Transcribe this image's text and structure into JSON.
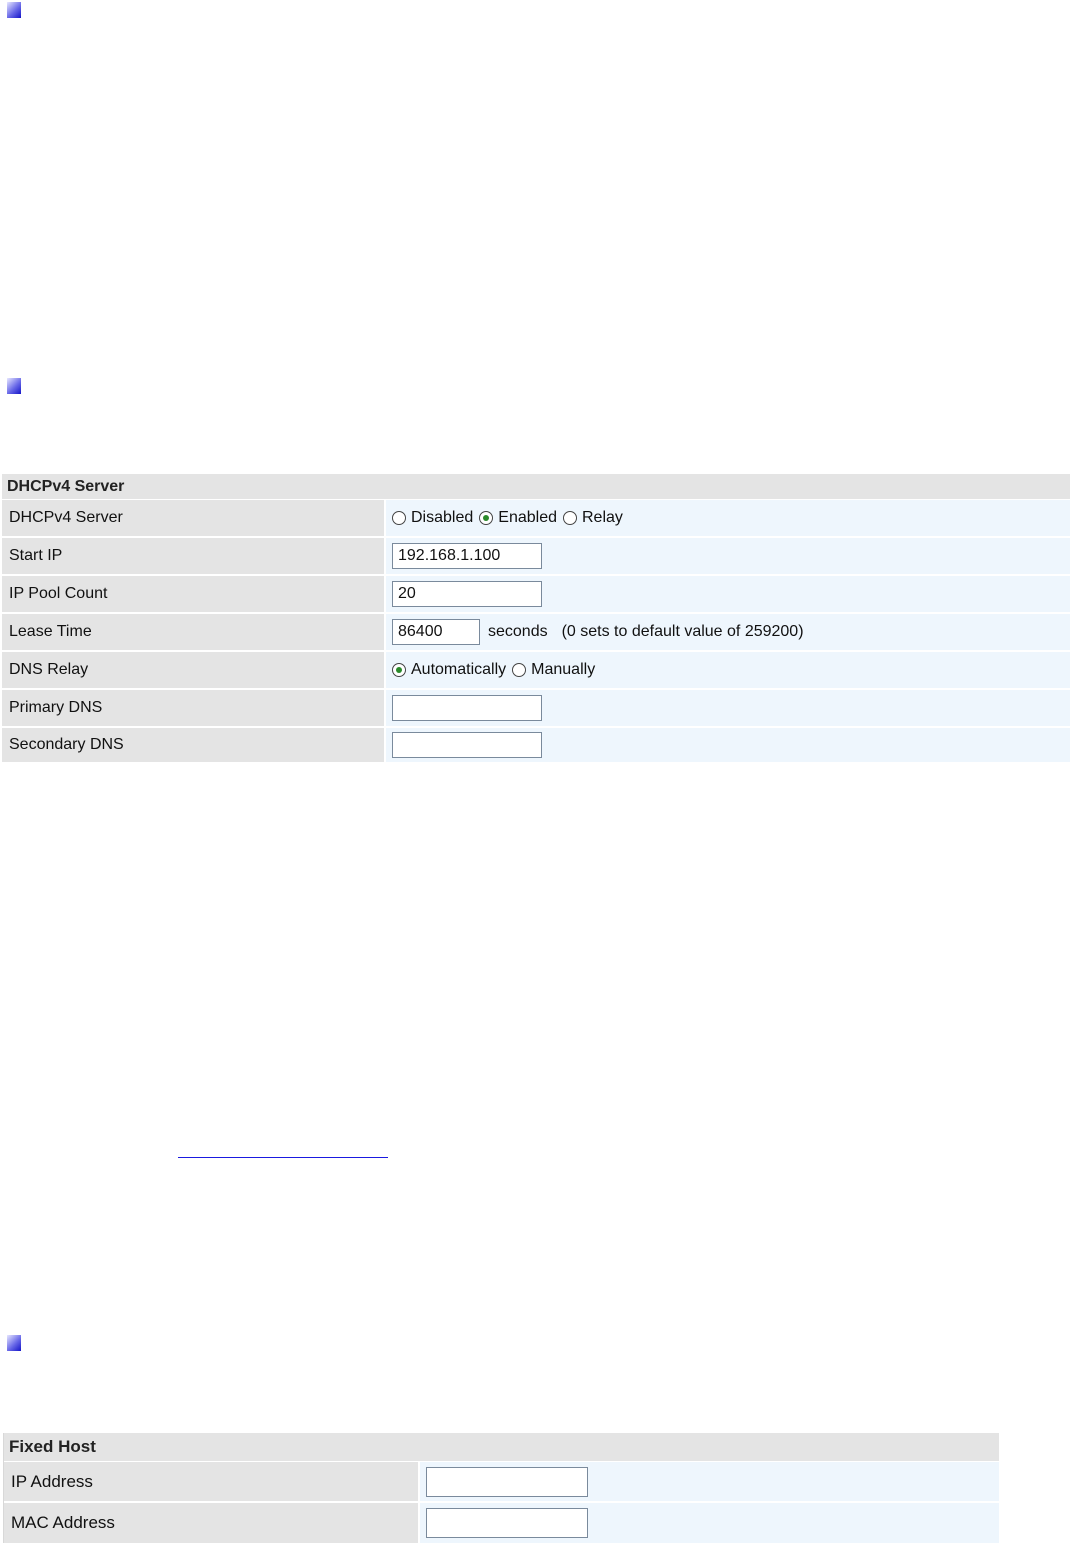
{
  "dhcp_table": {
    "title": "DHCPv4 Server",
    "rows": {
      "server": {
        "label": "DHCPv4 Server",
        "options": [
          "Disabled",
          "Enabled",
          "Relay"
        ],
        "selected": "Enabled"
      },
      "start_ip": {
        "label": "Start IP",
        "value": "192.168.1.100"
      },
      "pool_count": {
        "label": "IP Pool Count",
        "value": "20"
      },
      "lease_time": {
        "label": "Lease Time",
        "value": "86400",
        "unit": "seconds",
        "note": "(0 sets to default value of 259200)"
      },
      "dns_relay": {
        "label": "DNS Relay",
        "options": [
          "Automatically",
          "Manually"
        ],
        "selected": "Automatically"
      },
      "primary_dns": {
        "label": "Primary DNS",
        "value": ""
      },
      "secondary_dns": {
        "label": "Secondary DNS",
        "value": ""
      }
    }
  },
  "fixed_host_table": {
    "title": "Fixed Host",
    "rows": {
      "ip": {
        "label": "IP Address",
        "value": ""
      },
      "mac": {
        "label": "MAC Address",
        "value": ""
      }
    }
  },
  "colors": {
    "label_bg": "#e4e4e4",
    "value_bg": "#eef6fd",
    "marker": "#1414c8",
    "radio_selected": "#2a8a2a",
    "link": "#1a1ae0"
  }
}
